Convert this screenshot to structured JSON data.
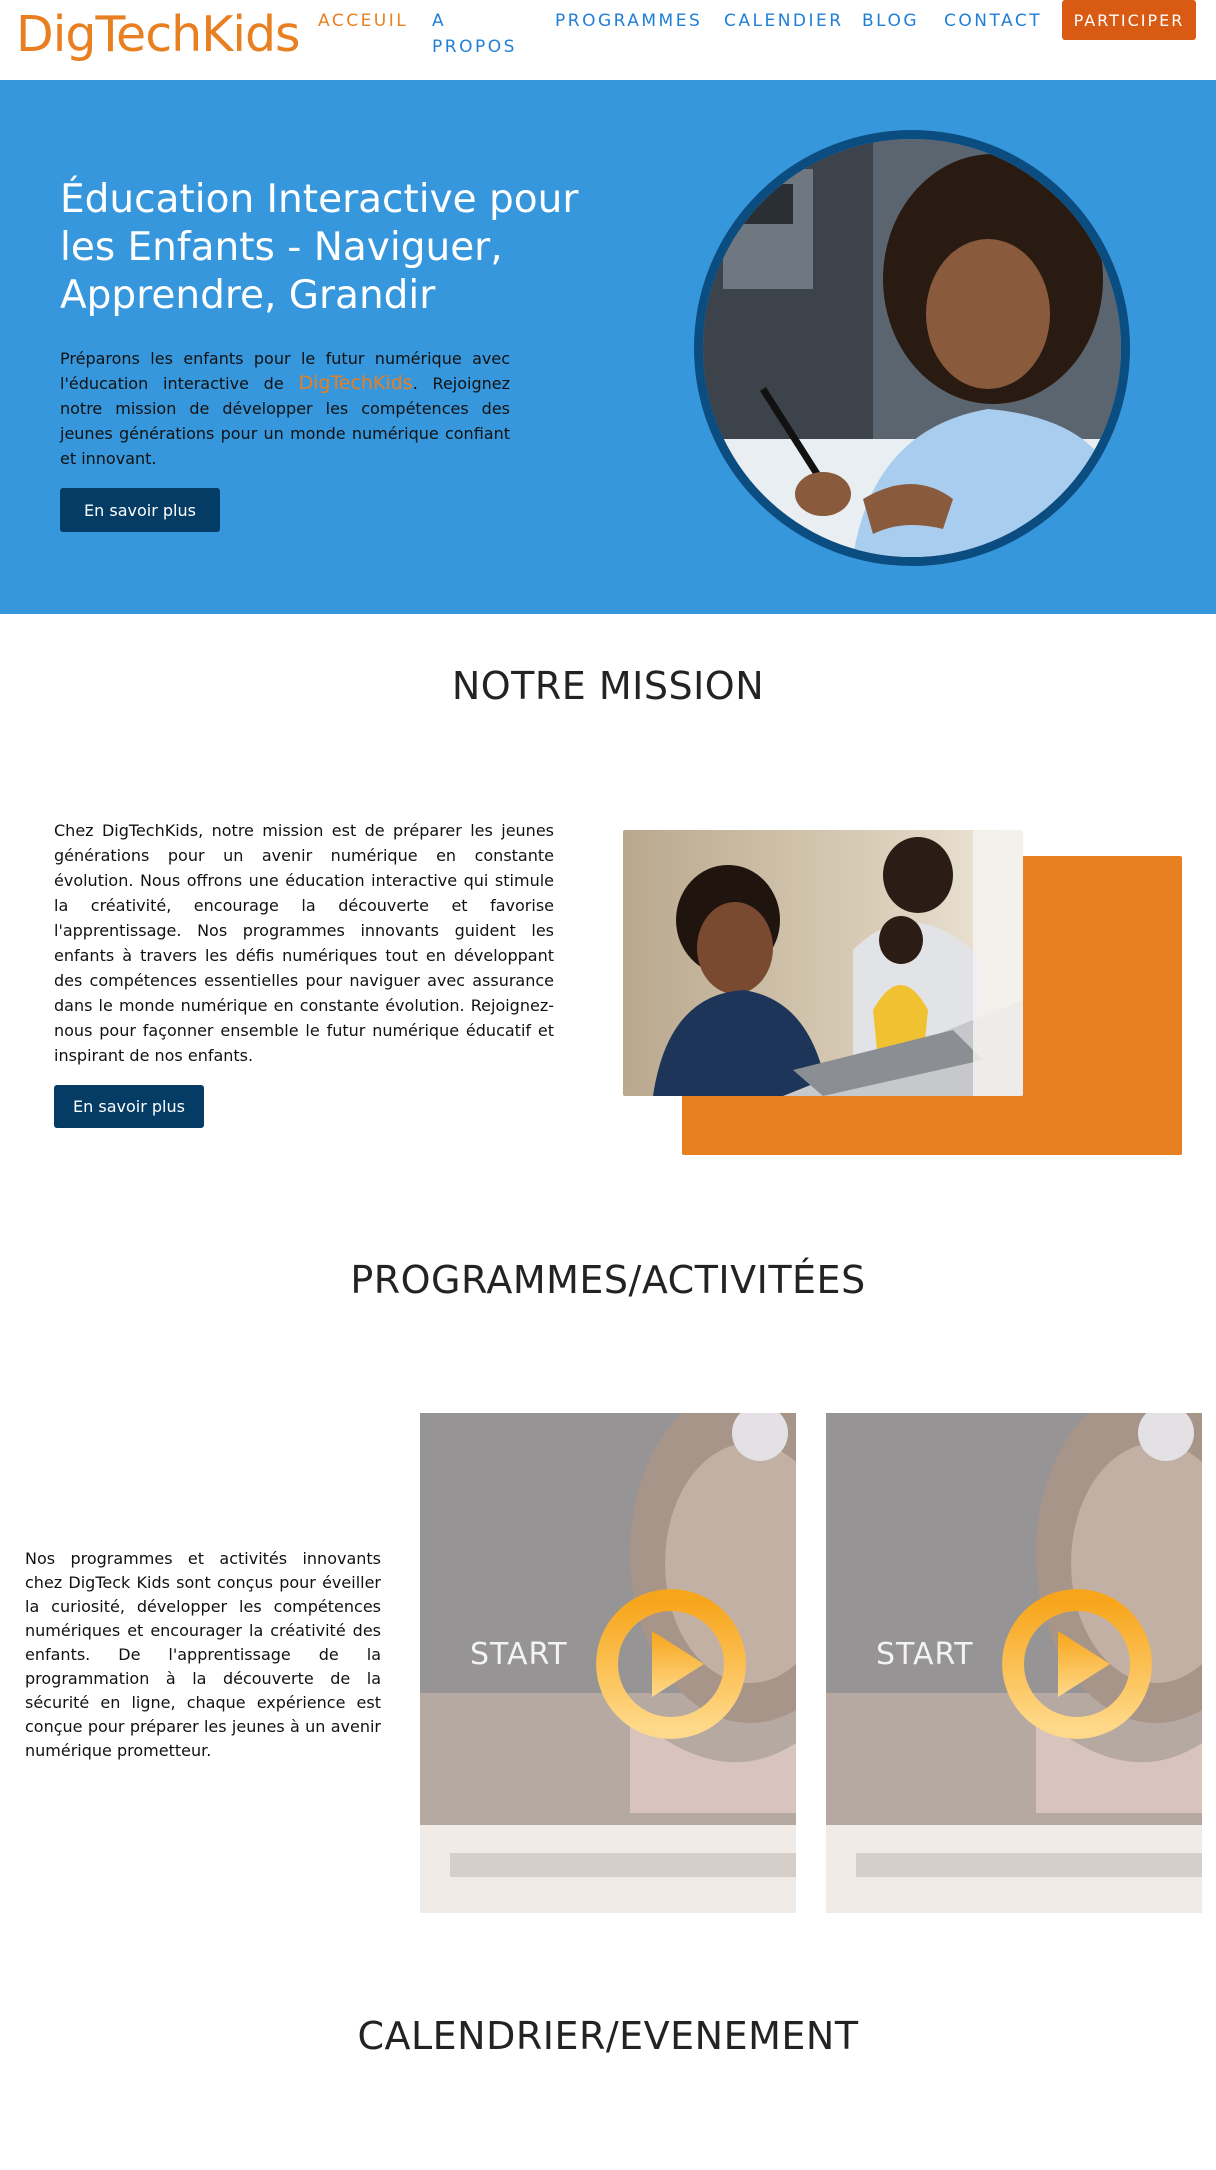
{
  "nav": {
    "logo": "DigTechKids",
    "links": [
      "ACCEUIL",
      "A",
      "PROPOS",
      "PROGRAMMES",
      "CALENDIER",
      "BLOG",
      "CONTACT"
    ],
    "cta": "PARTICIPER"
  },
  "hero": {
    "title": "Éducation Interactive pour les Enfants - Naviguer, Apprendre, Grandir",
    "text_before": "Préparons les enfants pour le futur numérique avec l'éducation interactive de ",
    "text_brand": "DigTechKids",
    "text_after": ". Rejoignez notre mission de développer les compétences des jeunes générations pour un monde numérique confiant et innovant.",
    "button": "En savoir plus"
  },
  "mission": {
    "title": "NOTRE MISSION",
    "text": "Chez DigTechKids, notre mission est de préparer les jeunes générations pour un avenir numérique en constante évolution. Nous offrons une éducation interactive qui stimule la créativité, encourage la découverte et favorise l'apprentissage. Nos programmes innovants guident les enfants à travers les défis numériques tout en développant des compétences essentielles pour naviguer avec assurance dans le monde numérique en constante évolution. Rejoignez-nous pour façonner ensemble le futur numérique éducatif et inspirant de nos enfants.",
    "button": "En savoir plus"
  },
  "programs": {
    "title": "PROGRAMMES/ACTIVITÉES",
    "text": "Nos programmes et activités innovants chez DigTeck Kids sont conçus pour éveiller la curiosité, développer les compétences numériques et encourager la créativité des enfants. De l'apprentissage de la programmation à la découverte de la sécurité en ligne, chaque expérience est conçue pour préparer les jeunes à un avenir numérique prometteur.",
    "cards": [
      {
        "label": "START"
      },
      {
        "label": "START"
      }
    ]
  },
  "calendar": {
    "title": "CALENDRIER/EVENEMENT"
  },
  "colors": {
    "accent_orange": "#e87f21",
    "hero_blue": "#3797dc",
    "nav_blue": "#1f7fd8",
    "dark_button": "#053c66",
    "cta_orange": "#d95a12"
  },
  "icons": [
    "play-icon"
  ]
}
